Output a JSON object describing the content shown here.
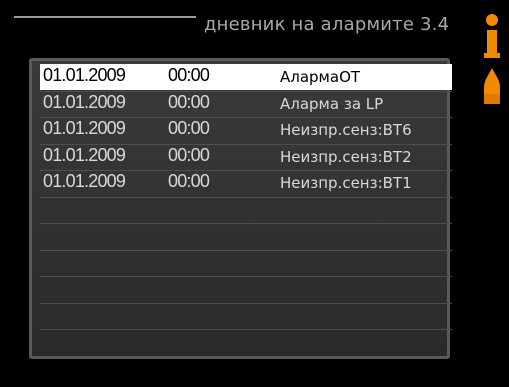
{
  "header": {
    "title": "дневник на алармите 3.4"
  },
  "icons": [
    "info-icon",
    "flame-icon"
  ],
  "colors": {
    "accent_orange": "#f28a00",
    "selected_bg": "#ffffff",
    "panel_bg": "#333333"
  },
  "alarm_log": {
    "rows": [
      {
        "date": "01.01.2009",
        "time": "00:00",
        "alarm": "АлармаОТ"
      },
      {
        "date": "01.01.2009",
        "time": "00:00",
        "alarm": "Аларма за LP"
      },
      {
        "date": "01.01.2009",
        "time": "00:00",
        "alarm": "Неизпр.сенз:BT6"
      },
      {
        "date": "01.01.2009",
        "time": "00:00",
        "alarm": "Неизпр.сенз:BT2"
      },
      {
        "date": "01.01.2009",
        "time": "00:00",
        "alarm": "Неизпр.сенз:BT1"
      }
    ],
    "selected_index": 0
  }
}
